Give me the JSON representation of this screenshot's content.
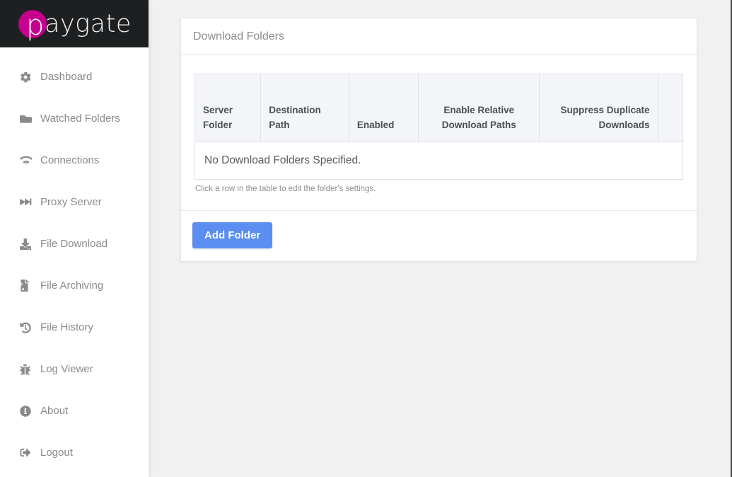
{
  "brand": {
    "logo_mark_letter": "p",
    "logo_text": "aygate",
    "logo_color": "#c5008e",
    "bar_color": "#1d1f21"
  },
  "sidebar": {
    "items": [
      {
        "label": "Dashboard",
        "icon": "gear-icon"
      },
      {
        "label": "Watched Folders",
        "icon": "folder-icon"
      },
      {
        "label": "Connections",
        "icon": "wifi-icon"
      },
      {
        "label": "Proxy Server",
        "icon": "fast-forward-icon"
      },
      {
        "label": "File Download",
        "icon": "download-icon"
      },
      {
        "label": "File Archiving",
        "icon": "file-archive-icon"
      },
      {
        "label": "File History",
        "icon": "history-icon"
      },
      {
        "label": "Log Viewer",
        "icon": "bug-icon"
      },
      {
        "label": "About",
        "icon": "info-circle-icon"
      },
      {
        "label": "Logout",
        "icon": "sign-out-icon"
      }
    ]
  },
  "panel": {
    "title": "Download Folders",
    "table": {
      "columns": [
        "Server Folder",
        "Destination Path",
        "Enabled",
        "Enable Relative Download Paths",
        "Suppress Duplicate Downloads",
        ""
      ],
      "rows": [],
      "empty_message": "No Download Folders Specified.",
      "hint": "Click a row in the table to edit the folder's settings."
    },
    "footer": {
      "add_button_label": "Add Folder",
      "accent_color": "#5b8ef0"
    }
  }
}
